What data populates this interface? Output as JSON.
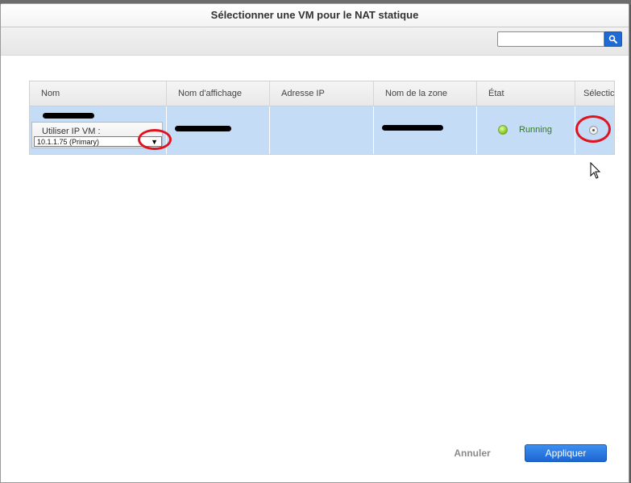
{
  "dialog": {
    "title": "Sélectionner une VM pour le NAT statique"
  },
  "search": {
    "value": "",
    "placeholder": "",
    "button_icon": "search-icon"
  },
  "grid": {
    "columns": [
      "Nom",
      "Nom d'affichage",
      "Adresse IP",
      "Nom de la zone",
      "État",
      "Sélectic"
    ],
    "rows": [
      {
        "name": "[redacted]",
        "ip_selector_label": "Utiliser IP VM :",
        "ip_selected": "10.1.1.75 (Primary)",
        "display_name": "[redacted]",
        "ip_address": "",
        "zone_name": "[redacted]",
        "state": "Running",
        "selected": false
      }
    ]
  },
  "buttons": {
    "cancel": "Annuler",
    "apply": "Appliquer"
  },
  "colors": {
    "accent": "#1f6bd6",
    "row_highlight": "#c5dcf7",
    "running": "#2e7d16",
    "annotation": "#e0141f"
  }
}
